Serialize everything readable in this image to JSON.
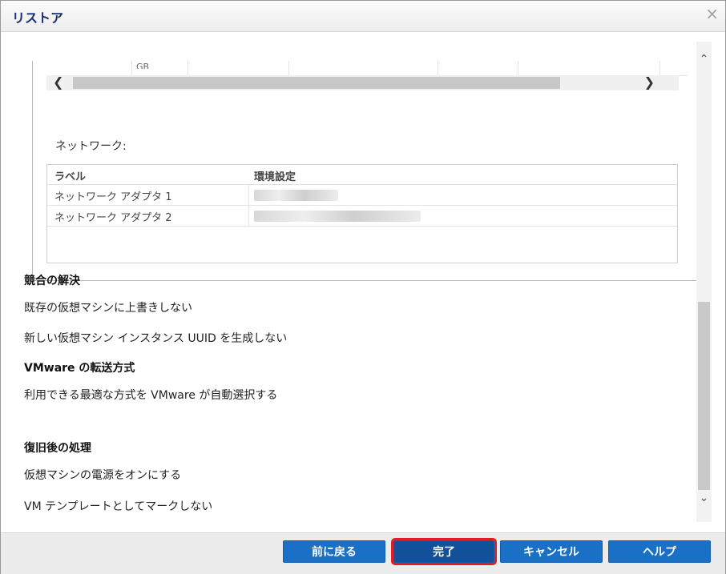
{
  "window": {
    "title": "リストア",
    "close_glyph": "×"
  },
  "disk_table_fragment": {
    "size_unit": "GB"
  },
  "network": {
    "label": "ネットワーク:",
    "columns": [
      "ラベル",
      "環境設定"
    ],
    "rows": [
      {
        "label": "ネットワーク アダプタ 1"
      },
      {
        "label": "ネットワーク アダプタ 2"
      }
    ]
  },
  "conflict": {
    "title": "競合の解決",
    "line1": "既存の仮想マシンに上書きしない",
    "line2": "新しい仮想マシン インスタンス UUID を生成しない"
  },
  "transport": {
    "title": "VMware の転送方式",
    "line1": "利用できる最適な方式を VMware が自動選択する"
  },
  "post": {
    "title": "復旧後の処理",
    "line1": "仮想マシンの電源をオンにする",
    "line2": "VM テンプレートとしてマークしない"
  },
  "buttons": {
    "back": "前に戻る",
    "finish": "完了",
    "cancel": "キャンセル",
    "help": "ヘルプ"
  },
  "colors": {
    "title_text": "#1a2e7a",
    "button_bg": "#1a70c6",
    "focus_outline": "#e21b24"
  }
}
